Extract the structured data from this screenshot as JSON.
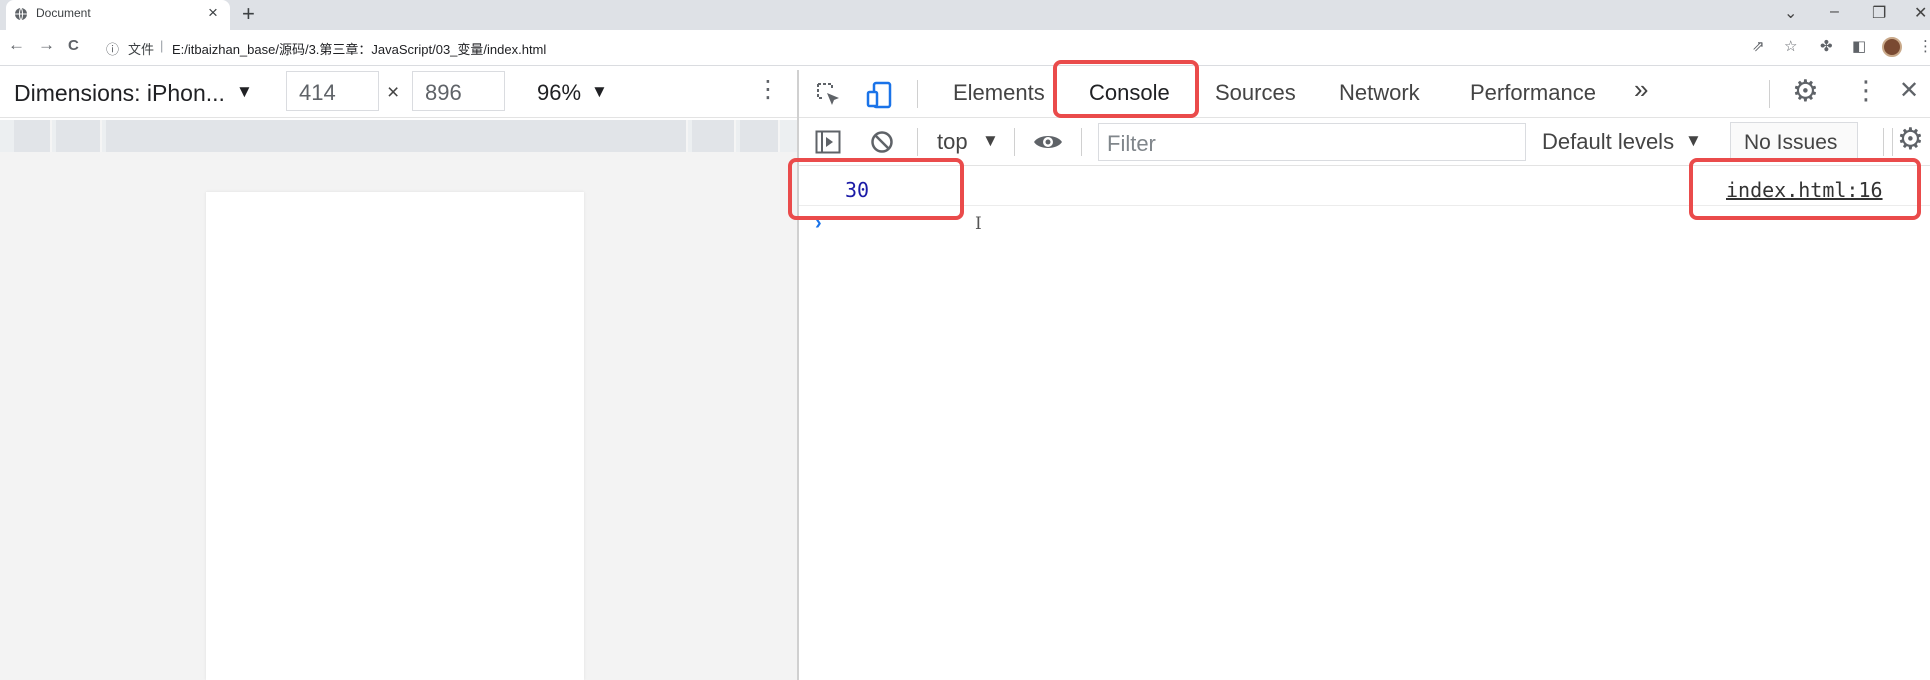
{
  "browser": {
    "tab_title": "Document",
    "new_tab": "+",
    "window_controls": {
      "chevron": "⌄",
      "minimize": "–",
      "restore": "❐",
      "close": "✕"
    },
    "nav": {
      "back": "←",
      "forward": "→",
      "reload": "C"
    },
    "omnibox": {
      "info_icon": "ⓘ",
      "label": "文件",
      "separator": "|",
      "url": "E:/itbaizhan_base/源码/3.第三章：JavaScript/03_变量/index.html"
    },
    "toolbar_icons": [
      "share-icon",
      "star-icon",
      "extensions-icon",
      "sidepanel-icon",
      "avatar",
      "menu-icon"
    ]
  },
  "device_toolbar": {
    "dimensions_label": "Dimensions: iPhon...",
    "width": "414",
    "times": "×",
    "height": "896",
    "zoom": "96%",
    "caret": "▼",
    "more": "⋮"
  },
  "devtools": {
    "tabs": [
      "Elements",
      "Console",
      "Sources",
      "Network",
      "Performance"
    ],
    "active_tab": "Console",
    "more_tabs": "»",
    "console_toolbar": {
      "context": "top",
      "filter_placeholder": "Filter",
      "levels": "Default levels",
      "issues": "No Issues"
    },
    "log": {
      "value": "30",
      "source": "index.html:16"
    },
    "prompt": "›",
    "text_cursor": "I"
  },
  "colors": {
    "highlight": "#ea4b4b",
    "log_number": "#1a1aa6",
    "prompt": "#1a73e8"
  }
}
